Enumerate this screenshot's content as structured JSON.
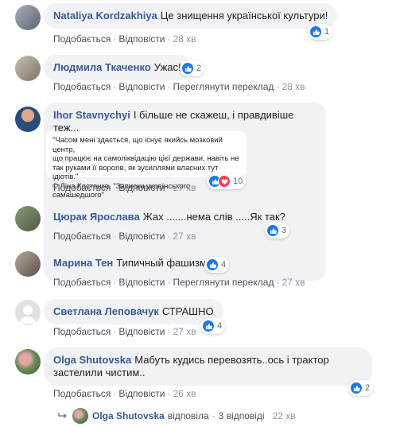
{
  "labels": {
    "like": "Подобається",
    "reply": "Відповісти",
    "translate": "Переглянути переклад",
    "dot": "·"
  },
  "colors": {
    "link": "#385898",
    "bubble": "#f0f2f5",
    "like": "#1877f2",
    "love": "#f33e58"
  },
  "comments": [
    {
      "author": "Nataliya Kordzakhiya",
      "text": "Це знищення української культури!",
      "time": "28 хв",
      "reactions": "1",
      "translate": false
    },
    {
      "author": "Людмила Ткаченко",
      "text": "Ужас!",
      "time": "28 хв",
      "reactions": "2",
      "translate": true
    },
    {
      "author": "Ihor Stavnychyi",
      "text": "І більше не скажеш, і правдивіше теж...",
      "time": "27 хв",
      "reactions": "10",
      "translate": false,
      "quote": {
        "lines": [
          "\"Часом мені здається, що існує якийсь мозковий центр,",
          "що працює на самоліквідацію цієї держави, навіть не",
          "так руками її ворогів, як зусиллями власних тут ідіотів.\"",
          "© Ліна Костенко, \"Записки українського самашедшого\""
        ]
      }
    },
    {
      "author": "Цюрак Ярослава",
      "text": "Жах .......нема слів .....Як так?",
      "time": "27 хв",
      "reactions": "3",
      "translate": false
    },
    {
      "author": "Марина Тен",
      "text": "Типичный фашизм",
      "time": "27 хв",
      "reactions": "4",
      "translate": true
    },
    {
      "author": "Светлана Леповачук",
      "text": "СТРАШНО",
      "time": "27 хв",
      "reactions": "4",
      "translate": false
    },
    {
      "author": "Olga Shutovska",
      "text_line1": "Мабуть кудись перевозять..ось і трактор",
      "text_line2": "застелили чистим..",
      "time": "26 хв",
      "reactions": "2",
      "translate": false
    }
  ],
  "reply_summary": {
    "author": "Olga Shutovska",
    "verb": "відповіла",
    "count": "3 відповіді",
    "time": "22 хв"
  }
}
